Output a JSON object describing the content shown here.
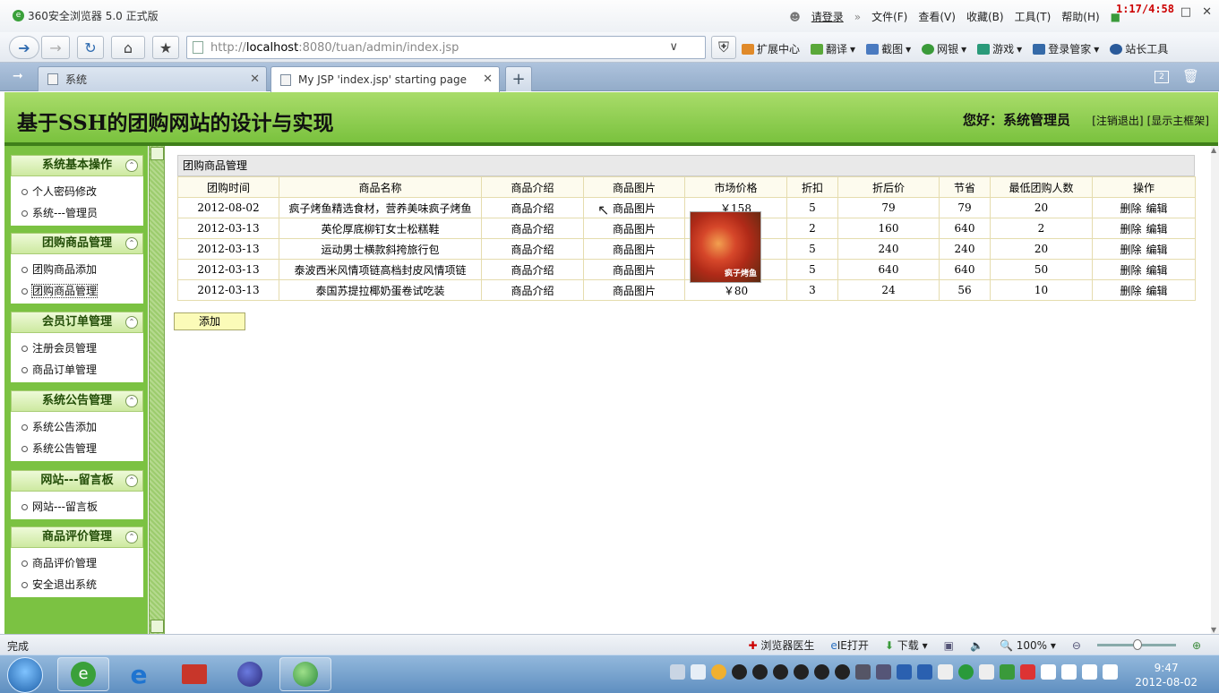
{
  "browser": {
    "title": "360安全浏览器 5.0 正式版",
    "menus": [
      "请登录",
      "文件(F)",
      "查看(V)",
      "收藏(B)",
      "工具(T)",
      "帮助(H)"
    ],
    "overlay_time": "1:17/4:58",
    "url_prefix": "http://",
    "url_host": "localhost",
    "url_rest": ":8080/tuan/admin/index.jsp",
    "tools": [
      "扩展中心",
      "翻译",
      "截图",
      "网银",
      "游戏",
      "登录管家",
      "站长工具"
    ],
    "tabs": [
      {
        "label": "系统",
        "active": false
      },
      {
        "label": "My JSP 'index.jsp' starting page",
        "active": true
      }
    ],
    "tab_count": "2"
  },
  "app": {
    "title": "基于SSH的团购网站的设计与实现",
    "greeting": "您好：系统管理员",
    "logout": "[注销退出]",
    "show_frame": "[显示主框架]"
  },
  "sidebar": [
    {
      "title": "系统基本操作",
      "items": [
        "个人密码修改",
        "系统---管理员"
      ]
    },
    {
      "title": "团购商品管理",
      "items": [
        "团购商品添加",
        "团购商品管理"
      ]
    },
    {
      "title": "会员订单管理",
      "items": [
        "注册会员管理",
        "商品订单管理"
      ]
    },
    {
      "title": "系统公告管理",
      "items": [
        "系统公告添加",
        "系统公告管理"
      ]
    },
    {
      "title": "网站---留言板",
      "items": [
        "网站---留言板"
      ]
    },
    {
      "title": "商品评价管理",
      "items": [
        "商品评价管理",
        "安全退出系统"
      ]
    }
  ],
  "table": {
    "title": "团购商品管理",
    "headers": [
      "团购时间",
      "商品名称",
      "商品介绍",
      "商品图片",
      "市场价格",
      "折扣",
      "折后价",
      "节省",
      "最低团购人数",
      "操作"
    ],
    "rows": [
      [
        "2012-08-02",
        "疯子烤鱼精选食材，营养美味疯子烤鱼",
        "商品介绍",
        "商品图片",
        "￥158",
        "5",
        "79",
        "79",
        "20",
        "删除 编辑"
      ],
      [
        "2012-03-13",
        "英伦厚底柳钉女士松糕鞋",
        "商品介绍",
        "商品图片",
        "",
        "2",
        "160",
        "640",
        "2",
        "删除 编辑"
      ],
      [
        "2012-03-13",
        "运动男士横款斜挎旅行包",
        "商品介绍",
        "商品图片",
        "",
        "5",
        "240",
        "240",
        "20",
        "删除 编辑"
      ],
      [
        "2012-03-13",
        "泰波西米风情项链高档封皮风情项链",
        "商品介绍",
        "商品图片",
        "",
        "5",
        "640",
        "640",
        "50",
        "删除 编辑"
      ],
      [
        "2012-03-13",
        "泰国苏提拉椰奶蛋卷试吃装",
        "商品介绍",
        "商品图片",
        "￥80",
        "3",
        "24",
        "56",
        "10",
        "删除 编辑"
      ]
    ],
    "add_label": "添加",
    "preview_caption": "疯子烤鱼"
  },
  "status": {
    "left": "完成",
    "doctor": "浏览器医生",
    "ie_open": "IE打开",
    "download": "下载",
    "zoom": "100%"
  },
  "taskbar": {
    "time": "9:47",
    "date": "2012-08-02"
  }
}
